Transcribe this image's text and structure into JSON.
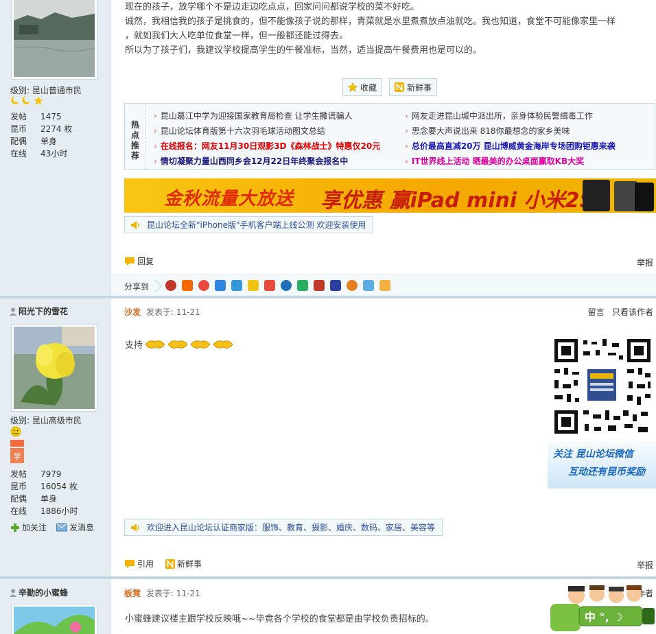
{
  "post1": {
    "level_label": "级别: 昆山普通市民",
    "stats": [
      {
        "k": "发帖",
        "v": "1475"
      },
      {
        "k": "昆币",
        "v": "2274 枚"
      },
      {
        "k": "配偶",
        "v": "单身"
      },
      {
        "k": "在线",
        "v": "43小时"
      }
    ],
    "lines": [
      "现在的孩子，放学哪个不是边走边吃点点，回家问问都说学校的菜不好吃。",
      "诚然，我相信我的孩子是挑食的，但不能像孩子说的那样，青菜就是水里煮煮放点油就吃。我也知道，食堂不可能像家里一样",
      "，就如我们大人吃单位食堂一样，但一般都还能过得去。",
      "所以为了孩子们，我建议学校提高学生的午餐准标，当然，适当提高午餐费用也是可以的。"
    ],
    "fav_label": "收藏",
    "news_label": "新鲜事",
    "hot": {
      "label": "热点推荐",
      "items_left": [
        {
          "text": "昆山葛江中学为迎接国家教育局检查 让学生撒谎骗人",
          "color": "#333333",
          "bold": false
        },
        {
          "text": "昆山论坛体育版第十六次羽毛球活动图文总结",
          "color": "#333333",
          "bold": false
        },
        {
          "text": "在线报名：网友11月30日观影3D《森林战士》特惠仅20元",
          "color": "#e00000",
          "bold": true
        },
        {
          "text": "情切凝聚力量山西同乡会12月22日年终聚会报名中",
          "color": "#1a1a7a",
          "bold": true
        }
      ],
      "items_right": [
        {
          "text": "网友走进昆山城中派出所，亲身体验民警缉毒工作",
          "color": "#333333",
          "bold": false
        },
        {
          "text": "思念要大声说出来 818你最想念的家乡美味",
          "color": "#333333",
          "bold": false
        },
        {
          "text": "总价最高直减20万 昆山博威黄金海岸专场团购钜惠来袭",
          "color": "#1a1ab0",
          "bold": true
        },
        {
          "text": "IT世界线上活动 晒最美的办公桌面赢取KB大奖",
          "color": "#e000a0",
          "bold": true
        }
      ]
    },
    "banner_text1": "金秋流量大放送",
    "banner_text2": "享优惠 赢iPad mini 小米2S",
    "notice": "昆山论坛全新\"iPhone版\"手机客户端上线公测 欢迎安装使用",
    "reply_label": "回复",
    "report_label": "举报",
    "share_label": "分享到"
  },
  "post2": {
    "author": "阳光下的雪花",
    "level_label": "级别: 昆山高级市民",
    "stats": [
      {
        "k": "发帖",
        "v": "7979"
      },
      {
        "k": "昆币",
        "v": "16054 枚"
      },
      {
        "k": "配偶",
        "v": "单身"
      },
      {
        "k": "在线",
        "v": "1886小时"
      }
    ],
    "follow_label": "加关注",
    "message_label": "发消息",
    "floor": "沙发",
    "posted": "发表于: 11-21",
    "leave_msg": "留言",
    "only_author": "只看该作者",
    "content": "支持",
    "qr_line1": "关注 昆山论坛微信",
    "qr_line2": "互动还有昆币奖励",
    "notice": "欢迎进入昆山论坛认证商家版：服饰、教育、摄影、婚庆、数码、家居、美容等",
    "quote_label": "引用",
    "news_label": "新鲜事",
    "report_label": "举报"
  },
  "post3": {
    "author": "辛勤的小蜜蜂",
    "floor": "板凳",
    "posted": "发表于: 11-21",
    "author_right": "作者",
    "content": "小蜜蜂建议楼主跟学校反映哦~~毕竟各个学校的食堂都是由学校负责招标的。"
  },
  "colors": {
    "sidebar": "#e5edf2",
    "border": "#c2d5e3",
    "floor": "#d96a1e"
  }
}
